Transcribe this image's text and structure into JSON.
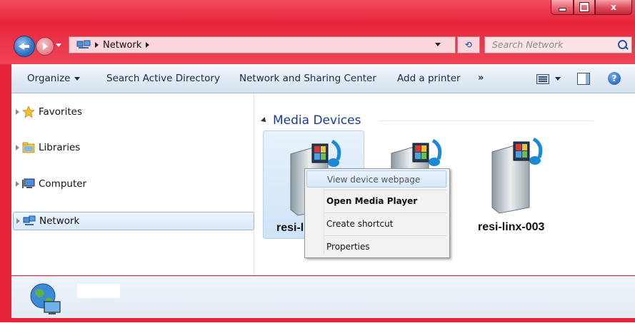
{
  "window": {
    "caption_buttons": {
      "minimize": "minimize",
      "maximize": "maximize",
      "close": "x"
    }
  },
  "address_bar": {
    "crumbs": [
      "Network"
    ],
    "search_placeholder": "Search Network"
  },
  "toolbar": {
    "organize": "Organize",
    "search_ad": "Search Active Directory",
    "network_sharing": "Network and Sharing Center",
    "add_printer": "Add a printer",
    "more": "»",
    "help": "?"
  },
  "nav_pane": {
    "items": [
      {
        "label": "Favorites",
        "icon": "star-icon"
      },
      {
        "label": "Libraries",
        "icon": "libraries-icon"
      },
      {
        "label": "Computer",
        "icon": "computer-icon"
      },
      {
        "label": "Network",
        "icon": "network-icon",
        "selected": true
      }
    ]
  },
  "content": {
    "group_header": "Media Devices",
    "devices": [
      {
        "label": "resi-l",
        "selected": true
      },
      {
        "label": "",
        "selected": false
      },
      {
        "label": "resi-linx-003",
        "selected": false
      }
    ]
  },
  "context_menu": {
    "items": [
      {
        "label": "View device webpage",
        "highlighted": true,
        "bold": false
      },
      {
        "label": "Open Media Player",
        "highlighted": false,
        "bold": true
      },
      {
        "label": "Create shortcut",
        "highlighted": false,
        "bold": false
      },
      {
        "label": "Properties",
        "highlighted": false,
        "bold": false
      }
    ]
  },
  "colors": {
    "chrome": "#e8243a",
    "accent_text": "#1e3b8a",
    "selection": "#cfe3f7"
  }
}
